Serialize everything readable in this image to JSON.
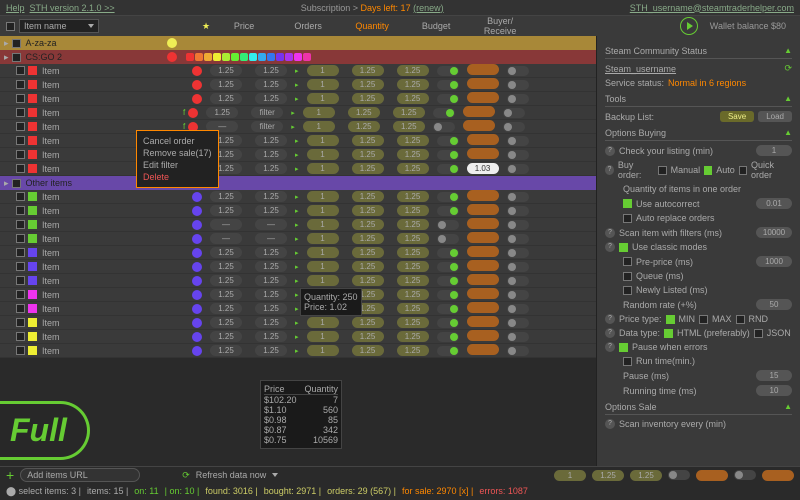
{
  "top": {
    "help": "Help",
    "version": "STH version 2.1.0 >>",
    "sub_label": "Subscription >",
    "days": "Days left: 17",
    "renew": "(renew)",
    "email": "STH_username@steamtraderhelper.com"
  },
  "header": {
    "dropdown": "Item name",
    "price": "Price",
    "orders": "Orders",
    "quantity": "Quantity",
    "budget": "Budget",
    "buyer": "Buyer",
    "receive": "/ Receive",
    "wallet": "Wallet balance $80"
  },
  "groups": [
    {
      "name": "A-za-za",
      "cls": "yellow",
      "dot": "#ee5"
    },
    {
      "name": "CS:GO 2",
      "cls": "red",
      "dot": "#e33"
    },
    {
      "name": "Other items",
      "cls": "purple",
      "dot": "#84e"
    }
  ],
  "row": {
    "name": "Item",
    "price": "1.25",
    "q": "1",
    "alt": "—",
    "special": "1.03",
    "filter": "filter"
  },
  "ctx": {
    "cancel": "Cancel order",
    "remove": "Remove sale",
    "count": "(17)",
    "edit": "Edit filter",
    "delete": "Delete"
  },
  "tip1": {
    "q": "Quantity: 250",
    "p": "Price: 1.02"
  },
  "tip2": {
    "hprice": "Price",
    "hqty": "Quantity",
    "rows": [
      [
        "$102.20",
        "7"
      ],
      [
        "$1.10",
        "560"
      ],
      [
        "$0.98",
        "85"
      ],
      [
        "$0.87",
        "342"
      ],
      [
        "$0.75",
        "10569"
      ]
    ]
  },
  "side": {
    "scs": "Steam Community Status",
    "user": "Steam_username",
    "svc_label": "Service status:",
    "svc": "Normal in 6 regions",
    "tools": "Tools",
    "backup": "Backup List:",
    "save": "Save",
    "load": "Load",
    "ob": "Options Buying",
    "check": "Check your listing (min)",
    "buyorder": "Buy order:",
    "manual": "Manual",
    "auto": "Auto",
    "quick": "Quick order",
    "qio": "Quantity of items in one order",
    "uac": "Use autocorrect",
    "aro": "Auto replace orders",
    "scan": "Scan item with filters (ms)",
    "scan_v": "10000",
    "ucm": "Use classic modes",
    "pp": "Pre-price (ms)",
    "pp_v": "1000",
    "queue": "Queue (ms)",
    "nl": "Newly Listed (ms)",
    "rr": "Random rate (+%)",
    "rr_v": "50",
    "ptype": "Price type:",
    "min": "MIN",
    "max": "MAX",
    "rnd": "RND",
    "dtype": "Data type:",
    "html": "HTML (preferably)",
    "json": "JSON",
    "pwe": "Pause when errors",
    "rtm": "Run time(min.)",
    "pause": "Pause (ms)",
    "pause_v": "15",
    "rt": "Running time (ms)",
    "rt_v": "10",
    "os": "Options Sale",
    "sie": "Scan inventory every (min)"
  },
  "footer": {
    "add": "Add items URL",
    "refresh": "Refresh data now",
    "p1": "1",
    "p2": "1.25",
    "p3": "1.25",
    "sel": "select items: 3 |",
    "items": "items: 15 |",
    "on1": "on: 11",
    "on2": "| on: 10 |",
    "found": "found: 3016 |",
    "bought": "bought: 2971 |",
    "orders": "orders: 29 (567) |",
    "forsale": "for sale: 2970 [x] |",
    "errors": "errors: 1087"
  },
  "full": "Full",
  "colors": [
    "#e33",
    "#e73",
    "#ea3",
    "#ee3",
    "#ae3",
    "#6e3",
    "#3e7",
    "#3ee",
    "#3ae",
    "#37e",
    "#73e",
    "#a3e",
    "#e3e",
    "#e3a"
  ]
}
